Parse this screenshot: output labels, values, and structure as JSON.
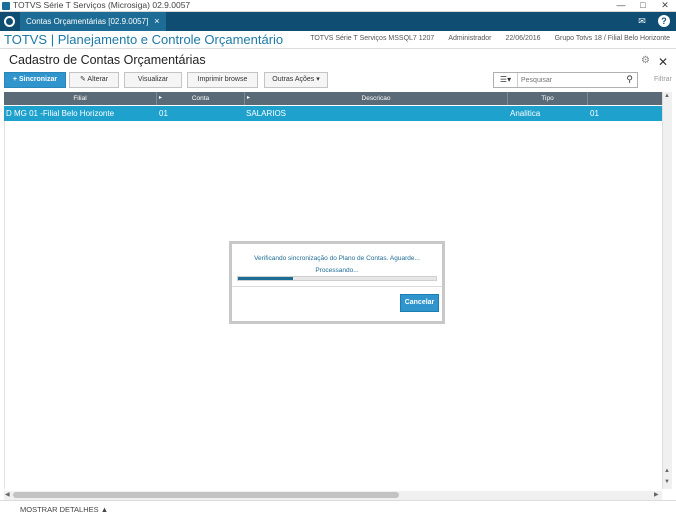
{
  "window": {
    "title": "TOTVS Série T Serviços (Microsiga) 02.9.0057"
  },
  "tabbar": {
    "tab_label": "Contas Orçamentárias [02.9.0057]"
  },
  "header": {
    "brand": "TOTVS | Planejamento e Controle Orçamentário",
    "environment": "TOTVS Série T Serviços MSSQL7 1207",
    "user": "Administrador",
    "date": "22/06/2016",
    "branch": "Grupo Totvs 18 / Filial Belo Horizonte"
  },
  "page": {
    "title": "Cadastro de Contas Orçamentárias"
  },
  "toolbar": {
    "sync_label": "+ Sincronizar",
    "edit_label": "Alterar",
    "view_label": "Visualizar",
    "print_label": "Imprimir browse",
    "more_label": "Outras Ações",
    "search_placeholder": "Pesquisar",
    "filter_label": "Filtrar"
  },
  "grid": {
    "columns": [
      "Filial",
      "Conta",
      "Descricao",
      "Tipo"
    ],
    "rows": [
      {
        "filial": "D MG 01 -Filial Belo Horizonte",
        "conta": "01",
        "descricao": "SALARIOS",
        "tipo": "Analitica",
        "extra": "01"
      }
    ]
  },
  "footer": {
    "details_label": "MOSTRAR DETALHES"
  },
  "modal": {
    "message": "Verificando sincronização do Plano de Contas. Aguarde...",
    "status": "Processando...",
    "progress": 0.28,
    "cancel_label": "Cancelar"
  },
  "colors": {
    "accent": "#1d6c95",
    "row_selected": "#1ea1cc",
    "tabbar": "#0f4e72"
  }
}
